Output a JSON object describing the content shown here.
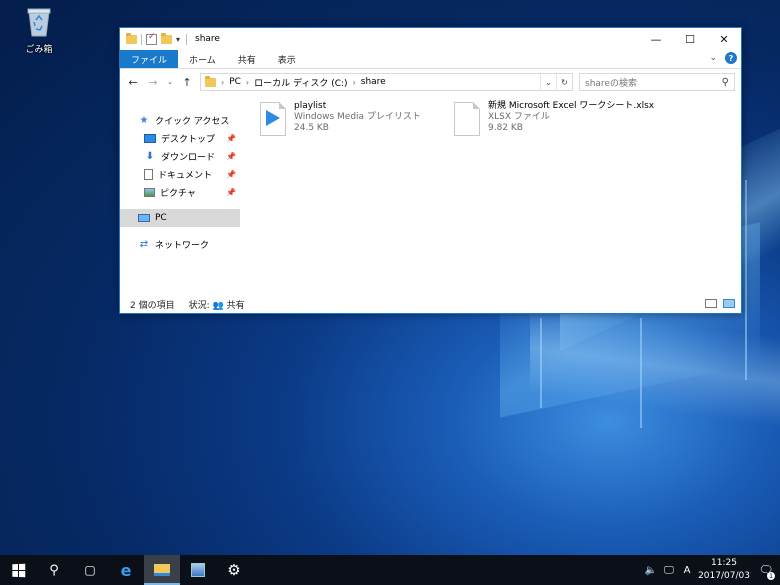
{
  "desktop": {
    "recycle_bin_label": "ごみ箱"
  },
  "window": {
    "title": "share",
    "controls": {
      "minimize": "—",
      "maximize": "☐",
      "close": "✕"
    },
    "ribbon_tabs": [
      "ファイル",
      "ホーム",
      "共有",
      "表示"
    ],
    "address": {
      "crumbs": [
        "PC",
        "ローカル ディスク (C:)",
        "share"
      ],
      "search_placeholder": "shareの検索"
    },
    "navpane": {
      "quick_access": "クイック アクセス",
      "items": [
        "デスクトップ",
        "ダウンロード",
        "ドキュメント",
        "ピクチャ"
      ],
      "pc": "PC",
      "network": "ネットワーク"
    },
    "files": [
      {
        "name": "playlist",
        "type": "Windows Media プレイリスト",
        "size": "24.5 KB",
        "icon": "playlist-icon"
      },
      {
        "name": "新規 Microsoft Excel ワークシート.xlsx",
        "type": "XLSX ファイル",
        "size": "9.82 KB",
        "icon": "document-icon"
      }
    ],
    "status": {
      "count": "2 個の項目",
      "state": "状況:",
      "shared": "共有"
    }
  },
  "taskbar": {
    "clock_time": "11:25",
    "clock_date": "2017/07/03",
    "ime": "A",
    "notification_count": "1"
  },
  "colors": {
    "accent": "#1979ca",
    "taskbar": "#0b0f18"
  }
}
